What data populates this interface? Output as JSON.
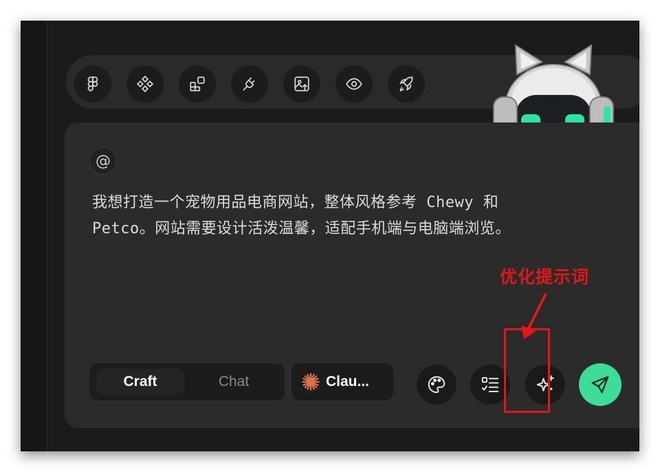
{
  "toolbar": {
    "tools": [
      {
        "icon": "figma-icon"
      },
      {
        "icon": "components-icon"
      },
      {
        "icon": "widgets-icon"
      },
      {
        "icon": "plug-icon"
      },
      {
        "icon": "image-upload-icon"
      },
      {
        "icon": "eye-icon"
      },
      {
        "icon": "rocket-icon"
      }
    ]
  },
  "composer": {
    "mention_symbol": "@",
    "prompt_line1": "我想打造一个宠物用品电商网站，整体风格参考 Chewy 和",
    "prompt_line2": "Petco。网站需要设计活泼温馨，适配手机端与电脑端浏览。",
    "mode_tabs": [
      {
        "label": "Craft",
        "active": true
      },
      {
        "label": "Chat",
        "active": false
      }
    ],
    "model_label": "Clau...",
    "actions": [
      {
        "icon": "palette-icon"
      },
      {
        "icon": "checklist-icon"
      },
      {
        "icon": "sparkle-plus-icon"
      }
    ],
    "send_icon": "send-icon"
  },
  "annotation": {
    "text": "优化提示词",
    "color": "#e01818"
  },
  "colors": {
    "accent": "#3ddc97",
    "background": "#1b1b1b",
    "panel": "#2b2b2b"
  }
}
